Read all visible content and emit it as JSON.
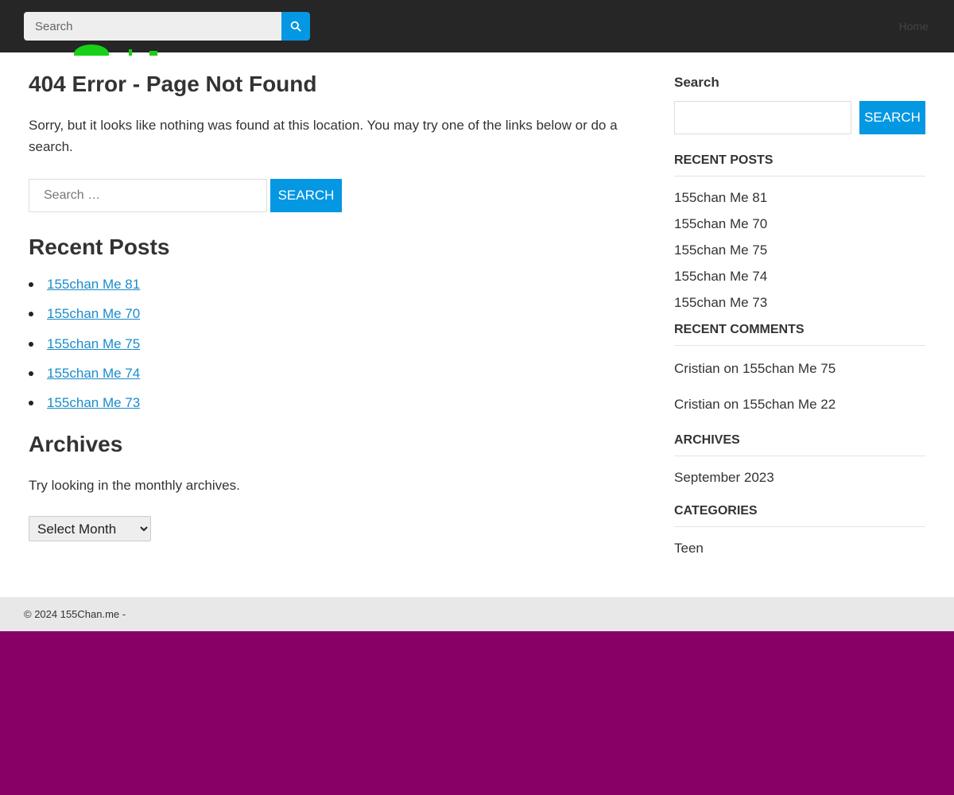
{
  "header": {
    "search_placeholder": "Search",
    "nav_item": "Home"
  },
  "main": {
    "title": "404 Error - Page Not Found",
    "intro": "Sorry, but it looks like nothing was found at this location. You may try one of the links below or do a search.",
    "search_placeholder": "Search …",
    "search_button": "SEARCH",
    "recent_posts_title": "Recent Posts",
    "recent_posts": [
      "155chan Me 81",
      "155chan Me 70",
      "155chan Me 75",
      "155chan Me 74",
      "155chan Me 73"
    ],
    "archives_title": "Archives",
    "archives_text": "Try looking in the monthly archives.",
    "month_select": "Select Month"
  },
  "sidebar": {
    "search_label": "Search",
    "search_button": "SEARCH",
    "recent_posts_title": "RECENT POSTS",
    "recent_posts": [
      "155chan Me 81",
      "155chan Me 70",
      "155chan Me 75",
      "155chan Me 74",
      "155chan Me 73"
    ],
    "recent_comments_title": "RECENT COMMENTS",
    "recent_comments": [
      "Cristian on 155chan Me 75",
      "Cristian on 155chan Me 22"
    ],
    "archives_title": "ARCHIVES",
    "archives": [
      "September 2023"
    ],
    "categories_title": "CATEGORIES",
    "categories": [
      "Teen"
    ]
  },
  "footer": {
    "text": "© 2024 155Chan.me -"
  },
  "colors": {
    "accent": "#0497e2",
    "topbar": "#262626",
    "page_background": "#880066",
    "link": "#1a8ccc"
  }
}
